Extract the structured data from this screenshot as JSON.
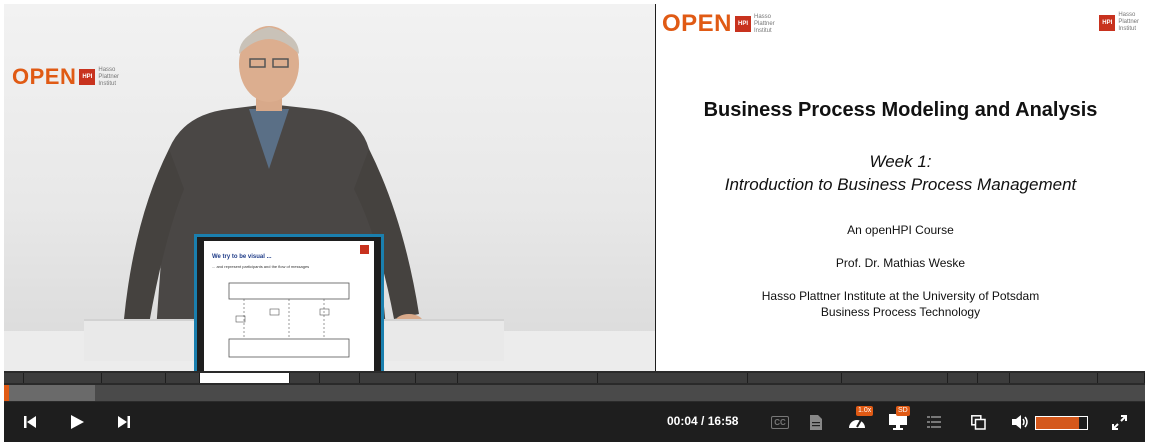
{
  "video": {
    "wall_logo": {
      "word": "OPEN",
      "badge": "HPI",
      "text": [
        "Hasso",
        "Plattner",
        "Institut"
      ]
    }
  },
  "slide": {
    "logo_word": "OPEN",
    "logo_badge": "HPI",
    "logo_text": [
      "Hasso",
      "Plattner",
      "Institut"
    ],
    "corner_badge": "HPI",
    "corner_text": [
      "Hasso",
      "Plattner",
      "Institut"
    ],
    "title": "Business Process Modeling and Analysis",
    "week": "Week 1:",
    "subtitle": "Introduction to Business Process Management",
    "course": "An openHPI Course",
    "professor": "Prof. Dr. Mathias Weske",
    "institute": "Hasso Plattner Institute at the University of Potsdam",
    "department": "Business Process Technology"
  },
  "preview": {
    "title": "We try to be visual ...",
    "subtitle": "... and represent participants and the flow of messages"
  },
  "timeline": {
    "played_fraction": 0.004,
    "buffered_fraction": 0.08
  },
  "controls": {
    "time_current": "00:04",
    "time_total": "16:58",
    "time_separator": " / ",
    "cc_label": "CC",
    "speed_label": "1.0x",
    "quality_label": "SD",
    "volume_level": 0.85
  },
  "colors": {
    "accent": "#e05a14",
    "preview_border": "#1a7fae",
    "background": "#1e1e1e"
  },
  "icons": [
    "skip-back-icon",
    "play-icon",
    "skip-forward-icon",
    "transcript-icon",
    "speed-icon",
    "quality-icon",
    "chapters-icon",
    "picture-in-picture-icon",
    "volume-icon",
    "fullscreen-icon"
  ]
}
